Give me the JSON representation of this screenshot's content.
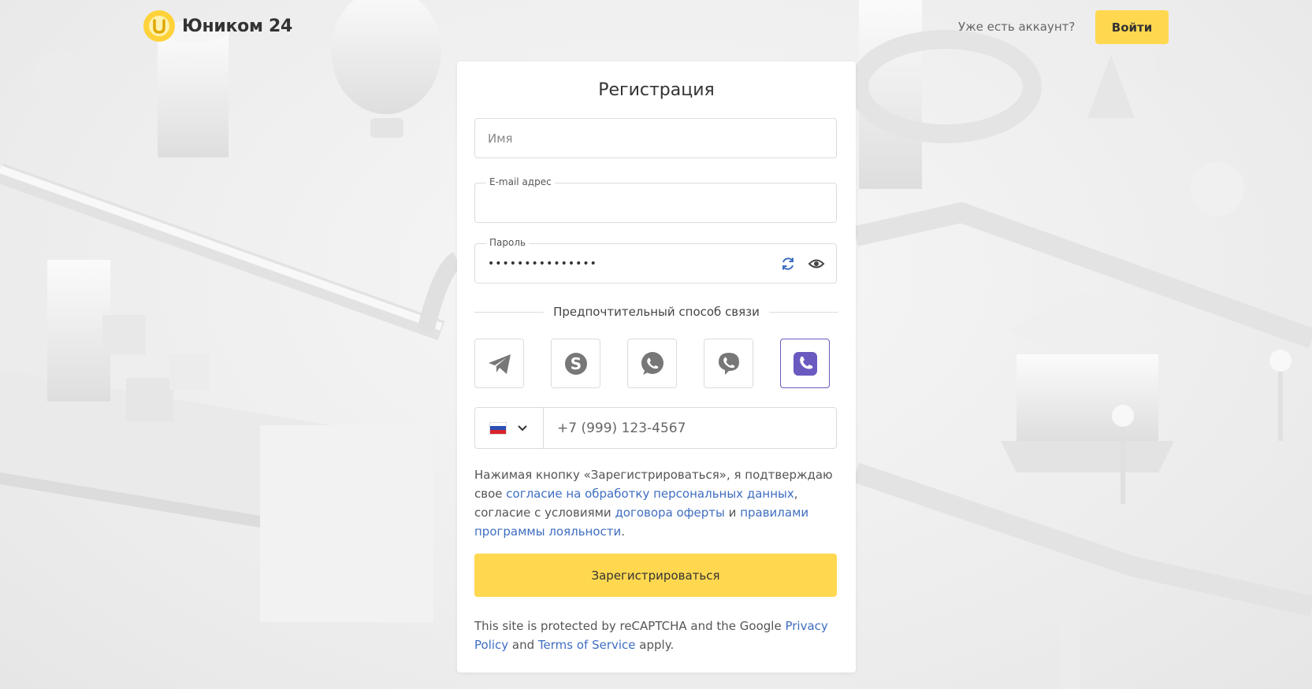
{
  "header": {
    "brand": "Юником 24",
    "already_text": "Уже есть аккаунт?",
    "login_label": "Войти"
  },
  "form": {
    "title": "Регистрация",
    "name": {
      "placeholder": "Имя",
      "value": ""
    },
    "email": {
      "label": "E-mail адрес",
      "value": ""
    },
    "password": {
      "label": "Пароль",
      "value": "•••••••••••••••"
    },
    "contact_heading": "Предпочтительный способ связи",
    "contact_methods": [
      {
        "icon": "telegram-icon",
        "selected": false
      },
      {
        "icon": "skype-icon",
        "selected": false
      },
      {
        "icon": "whatsapp-icon",
        "selected": false
      },
      {
        "icon": "viber-icon",
        "selected": false
      },
      {
        "icon": "phone-icon",
        "selected": true
      }
    ],
    "phone": {
      "country_flag": "russia-flag-icon",
      "placeholder": "+7 (999) 123-4567"
    },
    "consent": {
      "part1": "Нажимая кнопку «Зарегистрироваться», я подтверждаю свое ",
      "link1": "согласие на обработку персональных данных",
      "part2": ", согласие с условиями ",
      "link2": "договора оферты",
      "part3": " и ",
      "link3": "правилами программы лояльности",
      "part4": "."
    },
    "register_label": "Зарегистрироваться",
    "recaptcha": {
      "part1": "This site is protected by reCAPTCHA and the Google ",
      "link1": "Privacy Policy",
      "part2": " and ",
      "link2": "Terms of Service",
      "part3": " apply."
    }
  },
  "colors": {
    "accent": "#ffd850",
    "link": "#3f6ec1",
    "selected_contact": "#6a5ac0"
  }
}
